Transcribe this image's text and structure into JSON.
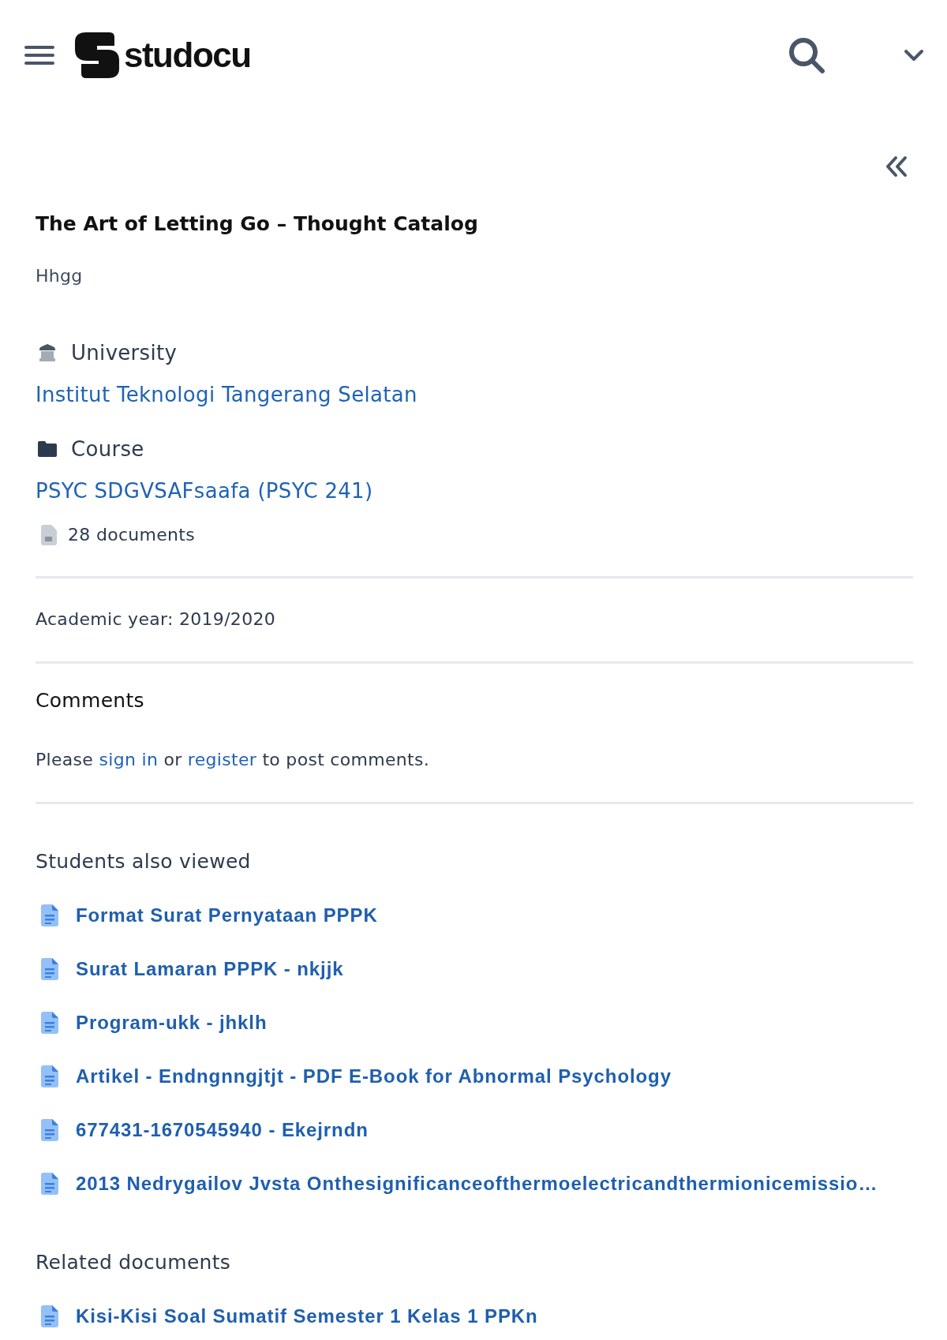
{
  "header": {
    "logo_text": "studocu"
  },
  "document": {
    "title": "The Art of Letting Go – Thought Catalog",
    "description": "Hhgg"
  },
  "details": [
    {
      "kind": "university",
      "label": "University",
      "value": "Institut Teknologi Tangerang Selatan"
    },
    {
      "kind": "course",
      "label": "Course",
      "value": "PSYC SDGVSAFsaafa (PSYC 241)",
      "count": "28 documents"
    }
  ],
  "academic_year": "Academic year: 2019/2020",
  "comments": {
    "heading": "Comments",
    "prompt": [
      {
        "kind": "text",
        "text": "Please "
      },
      {
        "kind": "link",
        "text": "sign in"
      },
      {
        "kind": "text",
        "text": " or "
      },
      {
        "kind": "link",
        "text": "register"
      },
      {
        "kind": "text",
        "text": " to post comments."
      }
    ]
  },
  "students_also_viewed": {
    "heading": "Students also viewed",
    "items": [
      "Format Surat Pernyataan PPPK",
      "Surat Lamaran PPPK - nkjjk",
      "Program-ukk - jhklh",
      "Artikel - Endngnngjtjt - PDF E-Book for Abnormal Psychology",
      "677431-1670545940 - Ekejrndn",
      "2013 Nedrygailov Jvsta Onthesignificanceofthermoelectricandthermionicemissio…"
    ]
  },
  "related_documents": {
    "heading": "Related documents",
    "items": [
      "Kisi-Kisi Soal Sumatif Semester 1 Kelas 1 PPKn"
    ]
  }
}
